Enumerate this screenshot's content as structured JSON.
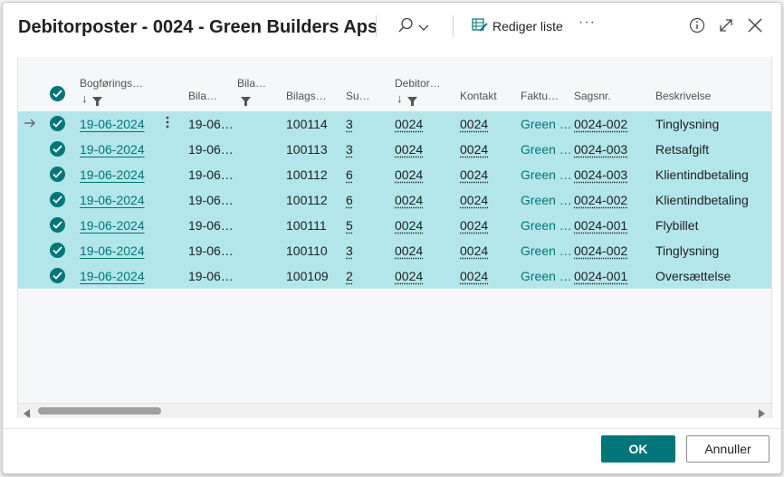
{
  "dialog": {
    "title": "Debitorposter - 0024 - Green Builders Aps",
    "edit_list_label": "Rediger liste",
    "more_label": "···",
    "ok_label": "OK",
    "cancel_label": "Annuller"
  },
  "columns": {
    "posting_date": "Bogførings…",
    "doc_date": "Bila…",
    "doc_type": "Bila…",
    "doc_no": "Bilags…",
    "su": "Su…",
    "customer": "Debitor…",
    "contact": "Kontakt",
    "invoice": "Faktu…",
    "job_no": "Sagsnr.",
    "description": "Beskrivelse"
  },
  "rows": [
    {
      "posting_date": "19-06-2024",
      "doc_date": "19-06…",
      "doc_no": "100114",
      "su": "3",
      "customer": "0024",
      "contact": "0024",
      "invoice": "Green …",
      "job_no": "0024-002",
      "description": "Tinglysning"
    },
    {
      "posting_date": "19-06-2024",
      "doc_date": "19-06…",
      "doc_no": "100113",
      "su": "3",
      "customer": "0024",
      "contact": "0024",
      "invoice": "Green …",
      "job_no": "0024-003",
      "description": "Retsafgift"
    },
    {
      "posting_date": "19-06-2024",
      "doc_date": "19-06…",
      "doc_no": "100112",
      "su": "6",
      "customer": "0024",
      "contact": "0024",
      "invoice": "Green …",
      "job_no": "0024-003",
      "description": "Klientindbetaling"
    },
    {
      "posting_date": "19-06-2024",
      "doc_date": "19-06…",
      "doc_no": "100112",
      "su": "6",
      "customer": "0024",
      "contact": "0024",
      "invoice": "Green …",
      "job_no": "0024-002",
      "description": "Klientindbetaling"
    },
    {
      "posting_date": "19-06-2024",
      "doc_date": "19-06…",
      "doc_no": "100111",
      "su": "5",
      "customer": "0024",
      "contact": "0024",
      "invoice": "Green …",
      "job_no": "0024-001",
      "description": "Flybillet"
    },
    {
      "posting_date": "19-06-2024",
      "doc_date": "19-06…",
      "doc_no": "100110",
      "su": "3",
      "customer": "0024",
      "contact": "0024",
      "invoice": "Green …",
      "job_no": "0024-002",
      "description": "Tinglysning"
    },
    {
      "posting_date": "19-06-2024",
      "doc_date": "19-06…",
      "doc_no": "100109",
      "su": "2",
      "customer": "0024",
      "contact": "0024",
      "invoice": "Green …",
      "job_no": "0024-001",
      "description": "Oversættelse"
    }
  ]
}
